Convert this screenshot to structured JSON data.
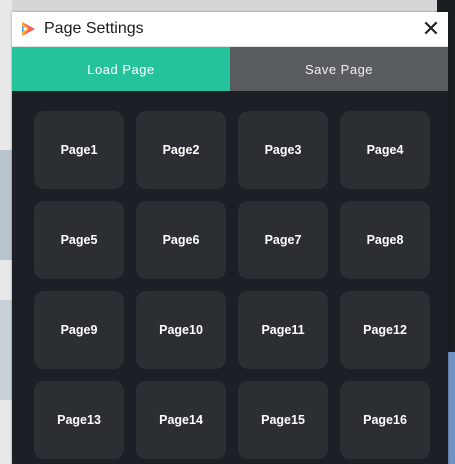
{
  "window": {
    "title": "Page Settings",
    "close_glyph": "✕",
    "icon": "app-logo-icon"
  },
  "tabs": [
    {
      "label": "Load Page",
      "active": true
    },
    {
      "label": "Save Page",
      "active": false
    }
  ],
  "pages": [
    "Page1",
    "Page2",
    "Page3",
    "Page4",
    "Page5",
    "Page6",
    "Page7",
    "Page8",
    "Page9",
    "Page10",
    "Page11",
    "Page12",
    "Page13",
    "Page14",
    "Page15",
    "Page16"
  ],
  "colors": {
    "accent": "#25c39c",
    "tab_inactive": "#5a5d60",
    "panel_bg": "#1c1f25",
    "tile_bg": "#2b2e33"
  }
}
